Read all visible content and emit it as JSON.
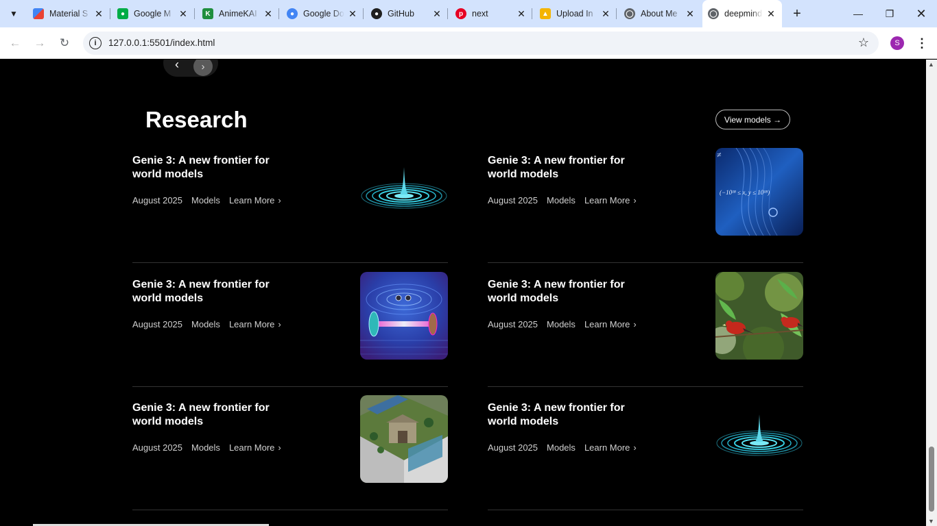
{
  "browser": {
    "tabs": [
      {
        "title": "Material S",
        "favicon": "material-icon",
        "color": "#e8453c"
      },
      {
        "title": "Google M",
        "favicon": "google-meet-icon",
        "color": "#00ac47"
      },
      {
        "title": "AnimeKAI",
        "favicon": "animekai-icon",
        "color": "#1e8e3e"
      },
      {
        "title": "Google Do",
        "favicon": "google-docs-icon",
        "color": "#4285f4"
      },
      {
        "title": "GitHub",
        "favicon": "github-icon",
        "color": "#1f1f1f"
      },
      {
        "title": "next",
        "favicon": "pinterest-icon",
        "color": "#e60023"
      },
      {
        "title": "Upload In",
        "favicon": "upload-icon",
        "color": "#f4b400"
      },
      {
        "title": "About Me",
        "favicon": "globe-icon",
        "color": "#5f6368"
      },
      {
        "title": "deepmind",
        "favicon": "globe-icon",
        "color": "#5f6368"
      }
    ],
    "url": "127.0.0.1:5501/index.html",
    "profile_initial": "S"
  },
  "page": {
    "section_title": "Research",
    "view_models_label": "View models →",
    "cards": [
      {
        "title": "Genie 3: A new frontier for world models",
        "date": "August 2025",
        "category": "Models",
        "link": "Learn More",
        "image": "ripple-rings"
      },
      {
        "title": "Genie 3: A new frontier for world models",
        "date": "August 2025",
        "category": "Models",
        "link": "Learn More",
        "image": "math-formula"
      },
      {
        "title": "Genie 3: A new frontier for world models",
        "date": "August 2025",
        "category": "Models",
        "link": "Learn More",
        "image": "laser-cavity"
      },
      {
        "title": "Genie 3: A new frontier for world models",
        "date": "August 2025",
        "category": "Models",
        "link": "Learn More",
        "image": "red-birds"
      },
      {
        "title": "Genie 3: A new frontier for world models",
        "date": "August 2025",
        "category": "Models",
        "link": "Learn More",
        "image": "isometric-garden"
      },
      {
        "title": "Genie 3: A new frontier for world models",
        "date": "August 2025",
        "category": "Models",
        "link": "Learn More",
        "image": "ripple-rings"
      }
    ],
    "formula_text": "(−10¹⁸ ≤ x, y ≤ 10¹⁸)"
  }
}
